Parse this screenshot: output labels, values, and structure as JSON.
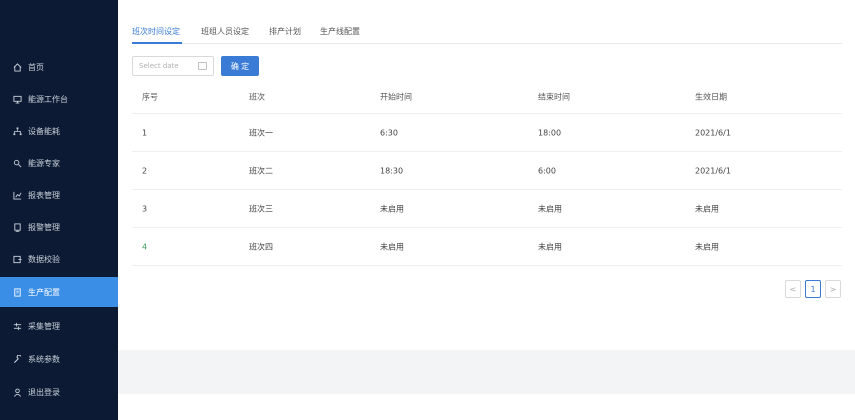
{
  "sidebar": {
    "items": [
      {
        "label": "首页",
        "icon": "home-icon",
        "active": false
      },
      {
        "label": "能源工作台",
        "icon": "monitor-icon",
        "active": false
      },
      {
        "label": "设备能耗",
        "icon": "device-tree-icon",
        "active": false
      },
      {
        "label": "能源专家",
        "icon": "expert-icon",
        "active": false
      },
      {
        "label": "报表管理",
        "icon": "chart-icon",
        "active": false
      },
      {
        "label": "报警管理",
        "icon": "alarm-icon",
        "active": false
      },
      {
        "label": "数据校验",
        "icon": "check-icon",
        "active": false
      },
      {
        "label": "生产配置",
        "icon": "config-icon",
        "active": true
      },
      {
        "label": "采集管理",
        "icon": "collect-icon",
        "active": false
      },
      {
        "label": "系统参数",
        "icon": "wrench-icon",
        "active": false
      },
      {
        "label": "退出登录",
        "icon": "user-icon",
        "active": false
      }
    ]
  },
  "tabs": [
    {
      "label": "班次时间设定",
      "active": true
    },
    {
      "label": "班组人员设定",
      "active": false
    },
    {
      "label": "排产计划",
      "active": false
    },
    {
      "label": "生产线配置",
      "active": false
    }
  ],
  "toolbar": {
    "date_placeholder": "Select date",
    "confirm_label": "确 定"
  },
  "table": {
    "headers": [
      "序号",
      "班次",
      "开始时间",
      "结束时间",
      "生效日期"
    ],
    "rows": [
      [
        "1",
        "班次一",
        "6:30",
        "18:00",
        "2021/6/1"
      ],
      [
        "2",
        "班次二",
        "18:30",
        "6:00",
        "2021/6/1"
      ],
      [
        "3",
        "班次三",
        "未启用",
        "未启用",
        "未启用"
      ],
      [
        "4",
        "班次四",
        "未启用",
        "未启用",
        "未启用"
      ]
    ]
  },
  "pagination": {
    "prev": "<",
    "current": "1",
    "next": ">"
  },
  "colors": {
    "sidebar_bg": "#0c1b33",
    "active_item": "#3a8ee6",
    "accent": "#3a7bd5"
  }
}
